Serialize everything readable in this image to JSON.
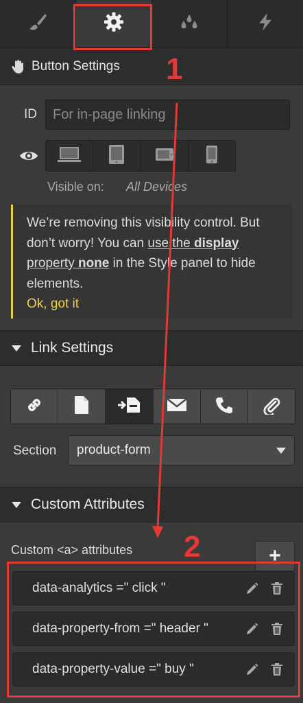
{
  "tabs": [
    {
      "name": "brush-icon",
      "active": false
    },
    {
      "name": "gear-icon",
      "active": true
    },
    {
      "name": "drops-icon",
      "active": false
    },
    {
      "name": "lightning-icon",
      "active": false
    }
  ],
  "button_settings": {
    "title": "Button Settings",
    "icon": "hand-pointer-icon"
  },
  "id_field": {
    "label": "ID",
    "placeholder": "For in-page linking"
  },
  "visibility": {
    "devices": [
      "desktop-icon",
      "tablet-icon",
      "mobile-landscape-icon",
      "mobile-portrait-icon"
    ],
    "label": "Visible on:",
    "value": "All Devices"
  },
  "notice": {
    "part1": "We’re removing this visibility control. But don’t worry! You can ",
    "link1": "use the ",
    "link1_bold": "display",
    "link2": "property",
    "link2_bold": "none",
    "part2": " in the Style panel to hide elements.",
    "ok": "Ok, got it",
    "accent_color": "#e8d24a"
  },
  "link_settings": {
    "title": "Link Settings",
    "types": [
      "url-link-icon",
      "page-icon",
      "section-link-icon",
      "email-icon",
      "phone-icon",
      "attachment-icon"
    ],
    "active_index": 2,
    "section_label": "Section",
    "section_value": "product-form"
  },
  "custom_attributes": {
    "title": "Custom Attributes",
    "subtitle": "Custom <a> attributes",
    "add_label": "+",
    "items": [
      {
        "text": "data-analytics =\" click \""
      },
      {
        "text": "data-property-from =\" header \""
      },
      {
        "text": "data-property-value =\" buy \""
      }
    ]
  },
  "annotations": {
    "step1": "1",
    "step2": "2",
    "color": "#e53935"
  }
}
